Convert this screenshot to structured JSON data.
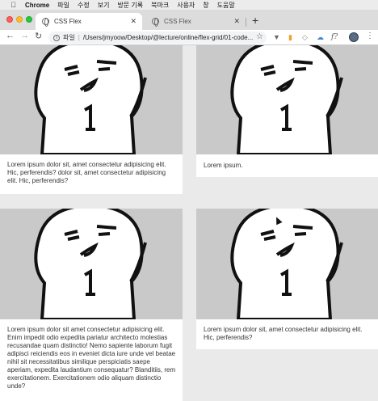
{
  "menubar": {
    "app_name": "Chrome",
    "items": [
      "파일",
      "수정",
      "보기",
      "방문 기록",
      "북마크",
      "사용자",
      "창",
      "도움말"
    ]
  },
  "tabs": [
    {
      "title": "CSS Flex",
      "active": true
    },
    {
      "title": "CSS Flex",
      "active": false
    }
  ],
  "toolbar": {
    "address_scheme": "파일",
    "address_url": "/Users/jmyoow/Desktop/@lecture/online/flex-grid/01-code..."
  },
  "cards": [
    {
      "text": "Lorem ipsum dolor sit, amet consectetur adipisicing elit. Hic, perferendis? dolor sit, amet consectetur adipisicing elit. Hic, perferendis?"
    },
    {
      "text": "Lorem ipsum."
    },
    {
      "text": "Lorem ipsum dolor sit amet consectetur adipisicing elit. Enim impedit odio expedita pariatur architecto molestias recusandae quam distinctio! Nemo sapiente laborum fugit adipisci reiciendis eos in eveniet dicta iure unde vel beatae nihil sit necessitatibus similique perspiciatis saepe aperiam, expedita laudantium consequatur? Blanditiis, rem exercitationem. Exercitationem odio aliquam distinctio unde?"
    },
    {
      "text": "Lorem ipsum dolor sit, amet consectetur adipisicing elit. Hic, perferendis?"
    }
  ]
}
